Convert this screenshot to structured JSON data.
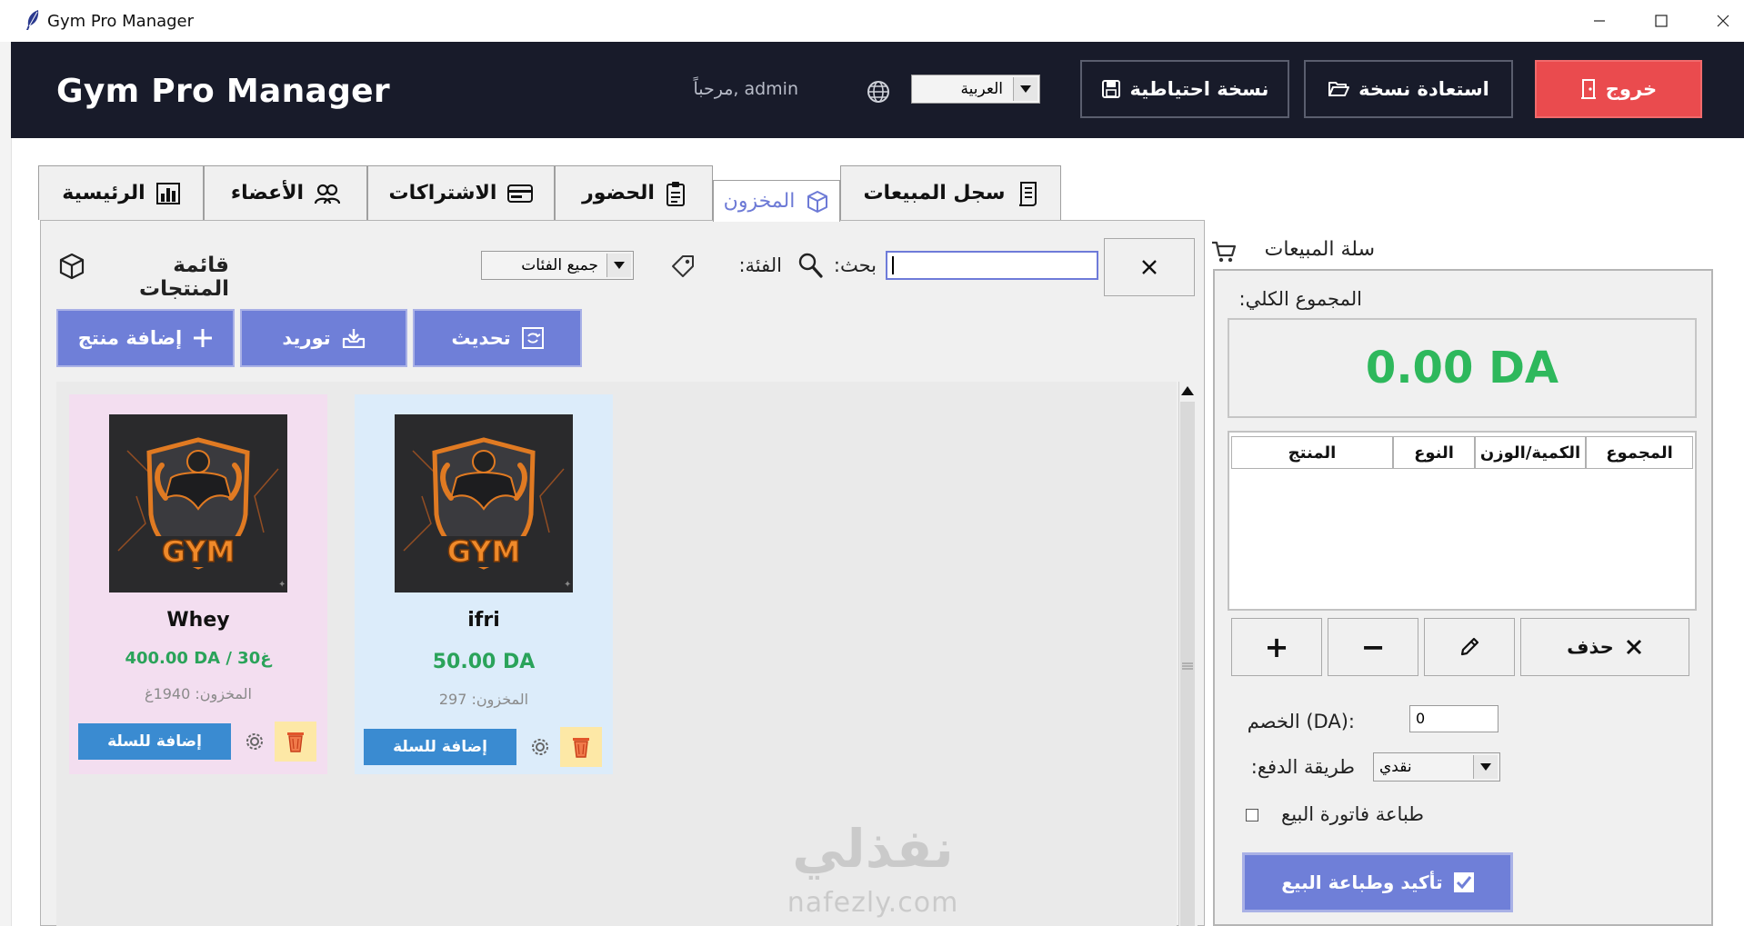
{
  "window": {
    "title": "Gym Pro Manager"
  },
  "header": {
    "app_title": "Gym Pro Manager",
    "welcome": "مرحباً, admin",
    "language_select": "العربية",
    "backup_label": "نسخة احتياطية",
    "restore_label": "استعادة نسخة",
    "logout_label": "خروج",
    "logout_color": "#ea4b4e"
  },
  "tabs": [
    {
      "label": "الرئيسية",
      "icon": "bar-chart-icon"
    },
    {
      "label": "الأعضاء",
      "icon": "users-icon"
    },
    {
      "label": "الاشتراكات",
      "icon": "card-icon"
    },
    {
      "label": "الحضور",
      "icon": "clipboard-icon"
    },
    {
      "label": "المخزون",
      "icon": "box-icon",
      "active": true
    },
    {
      "label": "سجل المبيعات",
      "icon": "scroll-icon"
    }
  ],
  "inventory": {
    "title": "قائمة المنتجات",
    "category_label": ":الفئة",
    "category_select": "جميع الفئات",
    "search_label": ":بحث",
    "search_value": "",
    "add_product_label": "إضافة منتج",
    "supply_label": "توريد",
    "refresh_label": "تحديث",
    "accent_color": "#6f7fd8",
    "products": [
      {
        "name": "Whey",
        "price": "400.00 DA / 30غ",
        "stock": "المخزون: 1940غ",
        "add_label": "إضافة للسلة",
        "image_text": "GYM"
      },
      {
        "name": "ifri",
        "price": "50.00 DA",
        "stock": "المخزون: 297",
        "add_label": "إضافة للسلة",
        "image_text": "GYM"
      }
    ],
    "watermark": {
      "ar": "نفذلي",
      "en": "nafezly.com"
    }
  },
  "cart": {
    "title": "سلة المبيعات",
    "total_label": ":المجموع الكلي",
    "total_value": "0.00 DA",
    "total_color": "#2eb85c",
    "columns": [
      "المجموع",
      "الكمية/الوزن",
      "النوع",
      "المنتج"
    ],
    "plus_label": "+",
    "minus_label": "−",
    "delete_label": "حذف",
    "discount_label": "الخصم (DA):",
    "discount_value": "0",
    "payment_label": ":طريقة الدفع",
    "payment_value": "نقدي",
    "print_label": "طباعة فاتورة البيع",
    "confirm_label": "تأكيد وطباعة البيع"
  }
}
